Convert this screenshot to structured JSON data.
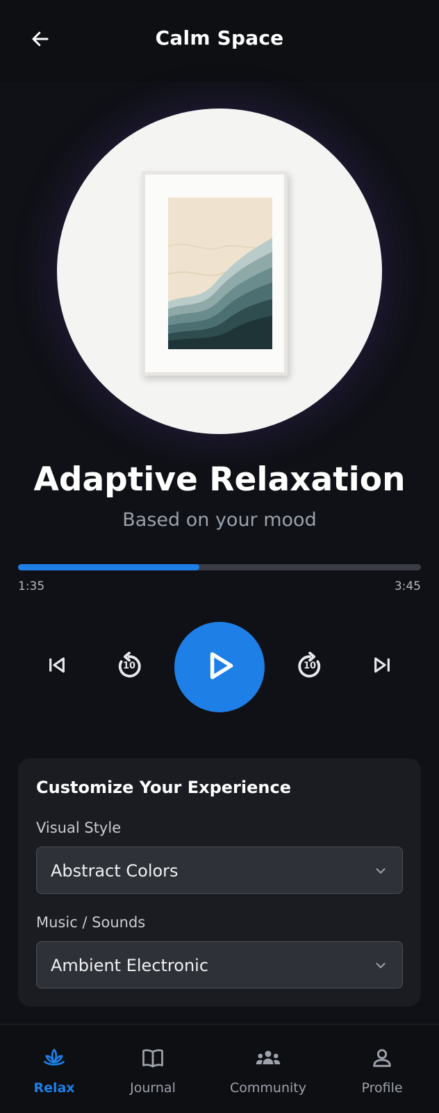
{
  "header": {
    "title": "Calm Space",
    "back_icon": "arrow-left-icon"
  },
  "now_playing": {
    "title": "Adaptive Relaxation",
    "subtitle": "Based on your mood",
    "progress_fraction": 0.45,
    "elapsed": "1:35",
    "duration": "3:45"
  },
  "controls": {
    "skip_back_seconds": "10",
    "skip_forward_seconds": "10",
    "icons": [
      "skip-previous-icon",
      "replay-10-icon",
      "play-icon",
      "forward-10-icon",
      "skip-next-icon"
    ]
  },
  "customize": {
    "title": "Customize Your Experience",
    "visual_style": {
      "label": "Visual Style",
      "value": "Abstract Colors"
    },
    "music": {
      "label": "Music / Sounds",
      "value": "Ambient Electronic"
    }
  },
  "nav": {
    "items": [
      {
        "label": "Relax",
        "icon": "lotus-icon",
        "active": true
      },
      {
        "label": "Journal",
        "icon": "book-icon",
        "active": false
      },
      {
        "label": "Community",
        "icon": "people-icon",
        "active": false
      },
      {
        "label": "Profile",
        "icon": "person-icon",
        "active": false
      }
    ]
  },
  "colors": {
    "accent": "#1E7FE6",
    "background": "#0F1116",
    "card": "#1A1C21",
    "muted_text": "#9BA1AB"
  }
}
